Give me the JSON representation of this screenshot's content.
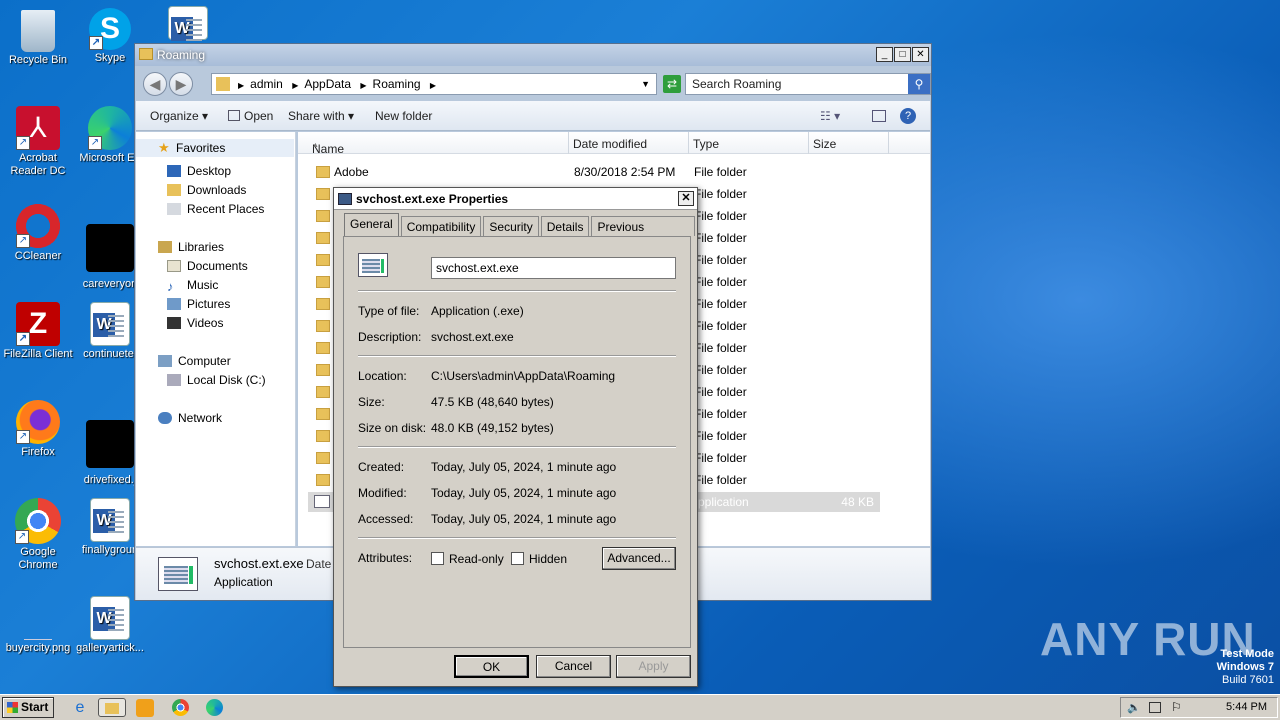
{
  "desktop": {
    "icons": [
      {
        "label": "Recycle Bin"
      },
      {
        "label": "Skype"
      },
      {
        "label": "Acrobat Reader DC"
      },
      {
        "label": "Microsoft Ed"
      },
      {
        "label": "CCleaner"
      },
      {
        "label": "careveryon"
      },
      {
        "label": "FileZilla Client"
      },
      {
        "label": "continuete."
      },
      {
        "label": "Firefox"
      },
      {
        "label": "drivefixed.j"
      },
      {
        "label": "Google Chrome"
      },
      {
        "label": "finallygroun"
      },
      {
        "label": "buyercity.png"
      },
      {
        "label": "galleryartick..."
      }
    ],
    "watermark": {
      "line1": "Test Mode",
      "line2": "Windows 7",
      "line3": "Build 7601"
    },
    "brand": "ANY RUN"
  },
  "explorer": {
    "title": "Roaming",
    "breadcrumb": [
      "admin",
      "AppData",
      "Roaming"
    ],
    "search_placeholder": "Search Roaming",
    "toolbar": {
      "organize": "Organize",
      "open": "Open",
      "share": "Share with",
      "new_folder": "New folder"
    },
    "nav": {
      "favorites": "Favorites",
      "desktop": "Desktop",
      "downloads": "Downloads",
      "recent": "Recent Places",
      "libraries": "Libraries",
      "documents": "Documents",
      "music": "Music",
      "pictures": "Pictures",
      "videos": "Videos",
      "computer": "Computer",
      "local_disk": "Local Disk (C:)",
      "network": "Network"
    },
    "columns": {
      "name": "Name",
      "date": "Date modified",
      "type": "Type",
      "size": "Size"
    },
    "first_row": {
      "name": "Adobe",
      "date": "8/30/2018 2:54 PM",
      "type": "File folder"
    },
    "folder_type": "File folder",
    "selected_row": {
      "type": "pplication",
      "size": "48 KB"
    },
    "details_pane": {
      "name": "svchost.ext.exe",
      "date_label": "Date",
      "type": "Application"
    }
  },
  "properties": {
    "title": "svchost.ext.exe Properties",
    "tabs": [
      "General",
      "Compatibility",
      "Security",
      "Details",
      "Previous Versions"
    ],
    "filename": "svchost.ext.exe",
    "labels": {
      "type": "Type of file:",
      "description": "Description:",
      "location": "Location:",
      "size": "Size:",
      "size_on_disk": "Size on disk:",
      "created": "Created:",
      "modified": "Modified:",
      "accessed": "Accessed:",
      "attributes": "Attributes:"
    },
    "values": {
      "type": "Application (.exe)",
      "description": "svchost.ext.exe",
      "location": "C:\\Users\\admin\\AppData\\Roaming",
      "size": "47.5 KB (48,640 bytes)",
      "size_on_disk": "48.0 KB (49,152 bytes)",
      "created": "Today, July 05, 2024, 1 minute ago",
      "modified": "Today, July 05, 2024, 1 minute ago",
      "accessed": "Today, July 05, 2024, 1 minute ago"
    },
    "readonly": "Read-only",
    "hidden": "Hidden",
    "advanced": "Advanced...",
    "ok": "OK",
    "cancel": "Cancel",
    "apply": "Apply"
  },
  "taskbar": {
    "start": "Start",
    "clock": "5:44 PM"
  }
}
